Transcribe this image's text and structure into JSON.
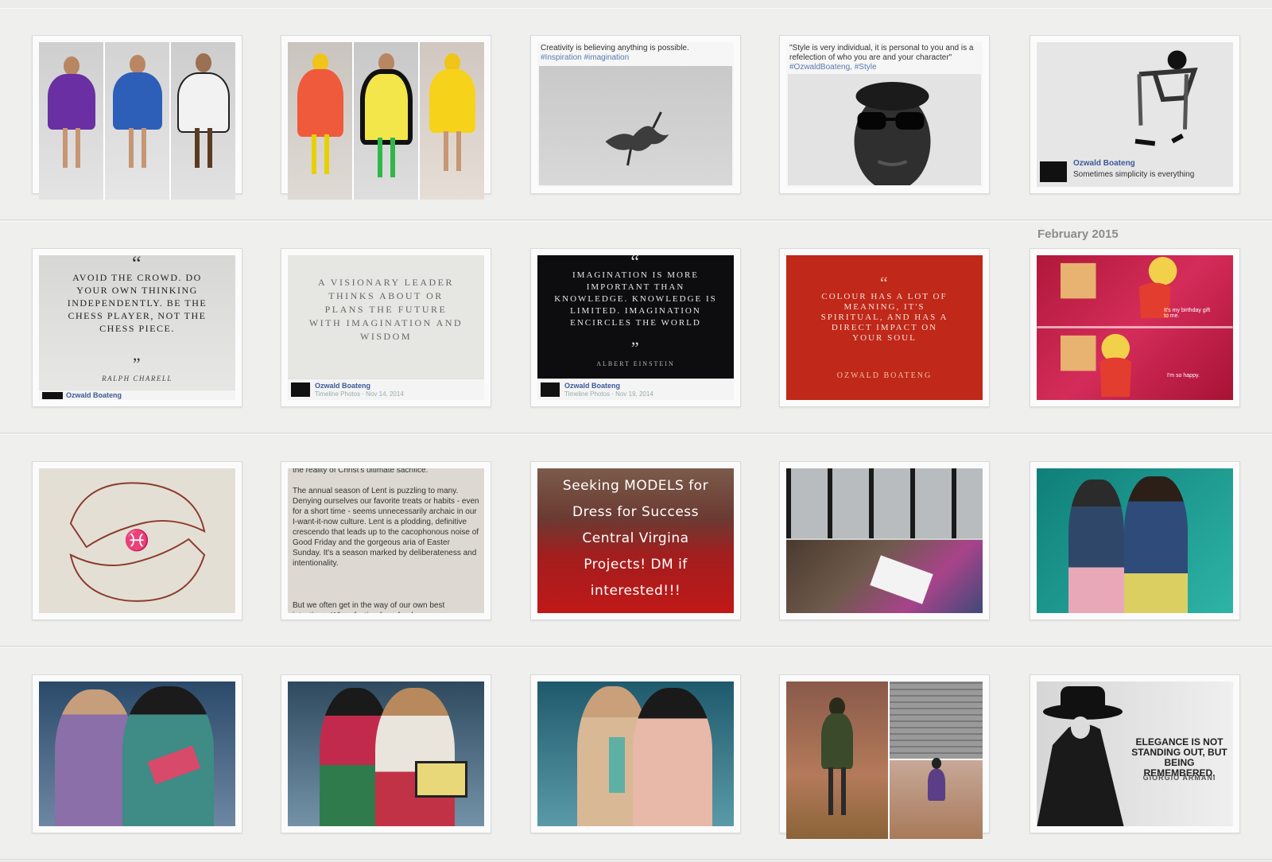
{
  "month_label": "February 2015",
  "tiles": {
    "r1c3": {
      "caption": "Creativity is believing anything is possible.",
      "tags": "#Inspiration #imagination"
    },
    "r1c4": {
      "caption": "\"Style is very individual, it is personal to you and is a refelection of who you are and your character\"",
      "tags": "#OzwaldBoateng, #Style"
    },
    "r1c5": {
      "author": "Ozwald Boateng",
      "text": "Sometimes simplicity is everything"
    },
    "r2c1": {
      "open_quote": "“",
      "quote": "Avoid the crowd. Do your own thinking independently. Be the chess player, not the chess piece.",
      "close_quote": "”",
      "attribution": "Ralph Charell",
      "author": "Ozwald Boateng"
    },
    "r2c2": {
      "quote": "A visionary leader thinks about or plans the future with imagination and wisdom",
      "author": "Ozwald Boateng",
      "meta": "Timeline Photos · Nov 14, 2014"
    },
    "r2c3": {
      "open_quote": "“",
      "quote": "Imagination is more important than knowledge. Knowledge is limited. Imagination encircles the world",
      "close_quote": "”",
      "attribution": "Albert Einstein",
      "author": "Ozwald Boateng",
      "meta": "Timeline Photos · Nov 19, 2014"
    },
    "r2c4": {
      "open_quote": "“",
      "quote": "Colour has a lot of meaning, it's spiritual, and has a direct impact on your soul",
      "attribution": "Ozwald Boateng"
    },
    "r2c5": {
      "bubble1": "It's my birthday gift to me.",
      "bubble2": "I'm so happy."
    },
    "r3c2": {
      "line0": "the reality of Christ's ultimate sacrifice.",
      "para1": "The annual season of Lent is puzzling to many. Denying ourselves our favorite treats or habits - even for a short time - seems unnecessarily archaic in our I-want-it-now culture. Lent is a plodding, definitive crescendo that leads up to the cacophonous noise of Good Friday and the gorgeous aria of Easter Sunday. It's a season marked by deliberateness and intentionality.",
      "para2": "But we often get in the way of our own best intentions. When fasting from food"
    },
    "r3c3": {
      "line1": "Seeking MODELS for",
      "line2": "Dress for Success",
      "line3": "Central Virgina",
      "line4": "Projects! DM if",
      "line5": "interested!!!"
    },
    "r4c5": {
      "quote": "Elegance is not standing out, but being remembered.",
      "attribution": "Giorgio Armani"
    }
  },
  "colors": {
    "background": "#ececeb",
    "quote_red": "#c0281a",
    "quote_black": "#0d0d0f",
    "facebook_blue": "#3b5998",
    "link_tag": "#5a7ab0"
  }
}
